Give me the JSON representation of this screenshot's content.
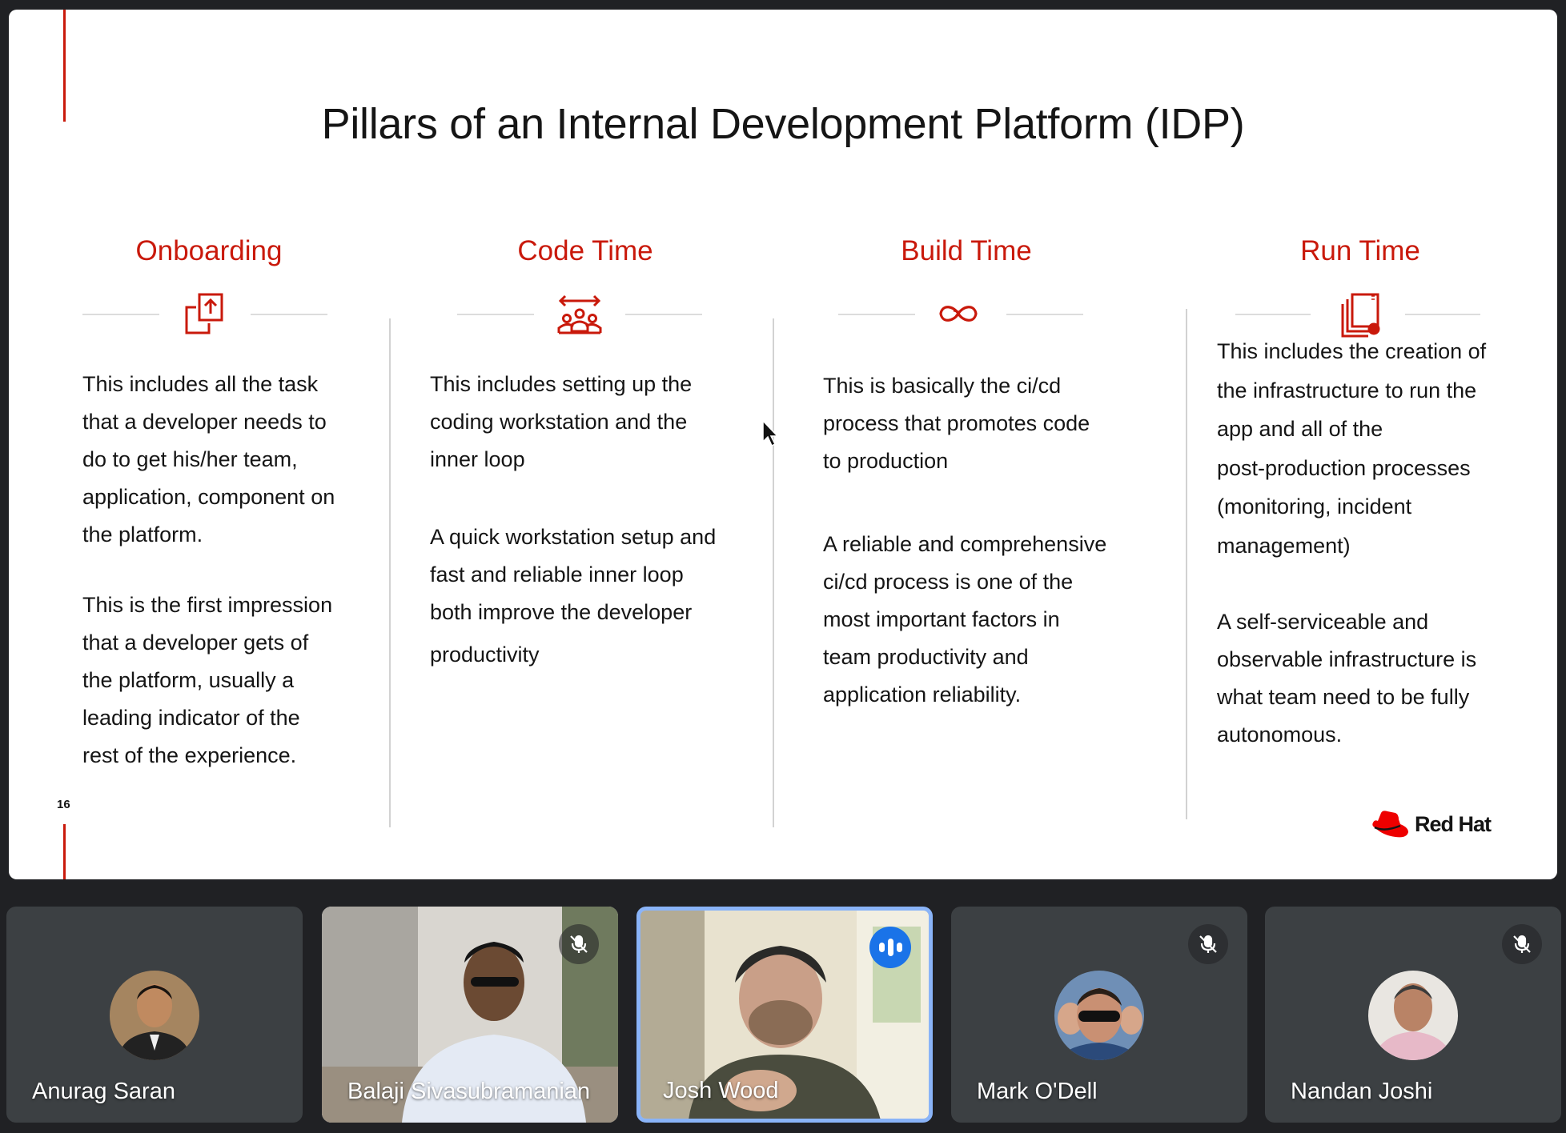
{
  "slide": {
    "title": "Pillars of an Internal Development Platform (IDP)",
    "page_number": "16",
    "brand": "Red Hat",
    "accent_color": "#c9190b",
    "pillars": [
      {
        "heading": "Onboarding",
        "icon": "share-upload-icon",
        "paragraphs": [
          [
            "This includes all the task",
            "that a developer needs to",
            "do to get his/her team,",
            "application, component on",
            "the platform."
          ],
          [
            "This is the first impression",
            "that a developer gets of",
            "the platform, usually a",
            "leading indicator of the",
            "rest of the experience."
          ]
        ]
      },
      {
        "heading": "Code Time",
        "icon": "team-arrows-icon",
        "paragraphs": [
          [
            "This includes setting up the",
            "coding workstation and the",
            "inner loop"
          ],
          [
            "A quick workstation setup and",
            "fast and reliable inner loop",
            "both improve the developer",
            "productivity"
          ]
        ]
      },
      {
        "heading": "Build Time",
        "icon": "infinity-icon",
        "paragraphs": [
          [
            "This is basically the ci/cd",
            "process that promotes code",
            "to production"
          ],
          [
            "A reliable and comprehensive",
            "ci/cd process is one of the",
            "most important factors in",
            "team productivity and",
            "application reliability."
          ]
        ]
      },
      {
        "heading": "Run Time",
        "icon": "stacked-pages-icon",
        "paragraphs": [
          [
            "This includes the creation of",
            "the infrastructure to run the",
            "app and all of the",
            "post-production processes",
            "(monitoring, incident",
            "management)"
          ],
          [
            "A self-serviceable and",
            "observable infrastructure is",
            "what team need to be fully",
            "autonomous."
          ]
        ]
      }
    ]
  },
  "participants": [
    {
      "name": "Anurag Saran",
      "muted": false,
      "video": false
    },
    {
      "name": "Balaji Sivasubramanian",
      "muted": true,
      "video": true
    },
    {
      "name": "Josh Wood",
      "muted": false,
      "video": true,
      "speaking": true
    },
    {
      "name": "Mark O'Dell",
      "muted": true,
      "video": false
    },
    {
      "name": "Nandan Joshi",
      "muted": true,
      "video": false
    }
  ]
}
